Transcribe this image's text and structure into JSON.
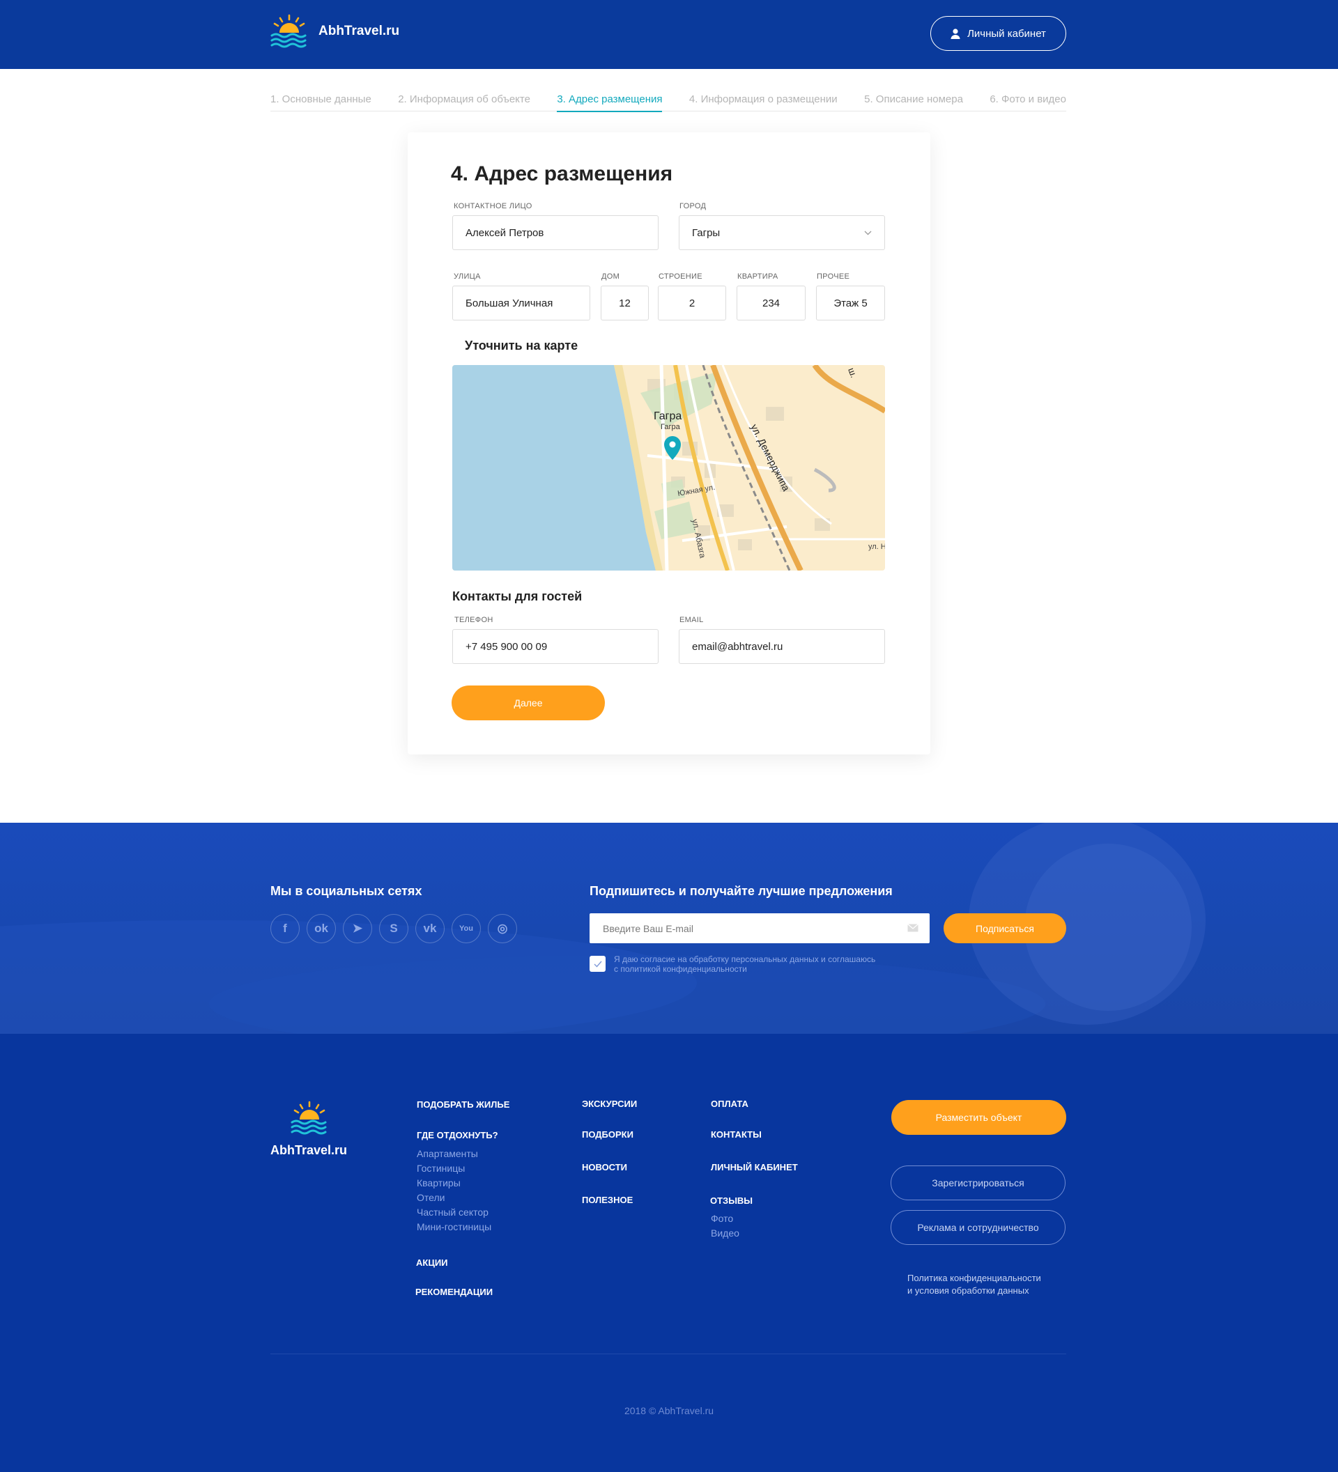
{
  "header": {
    "brand": "AbhTravel.ru",
    "cabinet_label": "Личный кабинет"
  },
  "steps": [
    {
      "label": "1. Основные данные"
    },
    {
      "label": "2. Информация об объекте"
    },
    {
      "label": "3. Адрес размещения"
    },
    {
      "label": "4. Информация о размещении"
    },
    {
      "label": "5. Описание номера"
    },
    {
      "label": "6. Фото и видео"
    }
  ],
  "form": {
    "title": "4. Адрес размещения",
    "contact_label": "Контактное лицо",
    "contact_value": "Алексей Петров",
    "city_label": "Город",
    "city_value": "Гагры",
    "street_label": "Улица",
    "street_value": "Большая Уличная",
    "house_label": "Дом",
    "house_value": "12",
    "building_label": "Строение",
    "building_value": "2",
    "apartment_label": "Квартира",
    "apartment_value": "234",
    "other_label": "Прочее",
    "other_value": "Этаж 5",
    "map_heading": "Уточнить на карте",
    "guests_heading": "Контакты для гостей",
    "phone_label": "Телефон",
    "phone_value": "+7 495 900 00 09",
    "email_label": "Email",
    "email_value": "email@abhtravel.ru",
    "next_label": "Далее"
  },
  "map": {
    "city_big": "Гагра",
    "city_small": "Гагра",
    "street_1": "ул. Демерджипа",
    "street_2": "Южная ул.",
    "street_3": "ул. Абазга",
    "street_4": "ул. Н",
    "street_5": "ш.",
    "pin_color": "#13a9bd",
    "sea_color": "#a9d2e6"
  },
  "subscribe": {
    "social_heading": "Мы в социальных сетях",
    "social_icons": [
      {
        "name": "facebook-icon",
        "glyph": "f"
      },
      {
        "name": "odnoklassniki-icon",
        "glyph": "ok"
      },
      {
        "name": "telegram-icon",
        "glyph": "➤"
      },
      {
        "name": "skype-icon",
        "glyph": "S"
      },
      {
        "name": "vk-icon",
        "glyph": "vk"
      },
      {
        "name": "youtube-icon",
        "glyph": "You"
      },
      {
        "name": "instagram-icon",
        "glyph": "◎"
      }
    ],
    "heading": "Подпишитесь и получайте лучшие предложения",
    "email_placeholder": "Введите Ваш E-mail",
    "button_label": "Подписаться",
    "consent_line1": "Я даю согласие на обработку персональных данных и соглашаюсь",
    "consent_line2": "с политикой конфиденциальности",
    "consent_checked": true
  },
  "footer": {
    "brand": "AbhTravel.ru",
    "col1": {
      "h1": "ПОДОБРАТЬ ЖИЛЬЕ",
      "h2": "ГДЕ ОТДОХНУТЬ?",
      "links": [
        "Апартаменты",
        "Гостиницы",
        "Квартиры",
        "Отели",
        "Частный сектор",
        "Мини-гостиницы"
      ],
      "h3": "АКЦИИ",
      "h4": "РЕКОМЕНДАЦИИ"
    },
    "col2": [
      "ЭКСКУРСИИ",
      "ПОДБОРКИ",
      "НОВОСТИ",
      "ПОЛЕЗНОЕ"
    ],
    "col3": {
      "items": [
        "ОПЛАТА",
        "КОНТАКТЫ",
        "ЛИЧНЫЙ КАБИНЕТ",
        "ОТЗЫВЫ"
      ],
      "links": [
        "Фото",
        "Видео"
      ]
    },
    "place_btn": "Разместить объект",
    "register_btn": "Зарегистрироваться",
    "ads_btn": "Реклама и сотрудничество",
    "policy_line1": "Политика конфиденциальности",
    "policy_line2": "и условия обработки данных",
    "copyright": "2018 © AbhTravel.ru"
  },
  "colors": {
    "header_bg": "#0a3a9c",
    "accent_orange": "#ffa01c",
    "accent_teal": "#13a9bd",
    "footer_bg": "#08369e"
  }
}
